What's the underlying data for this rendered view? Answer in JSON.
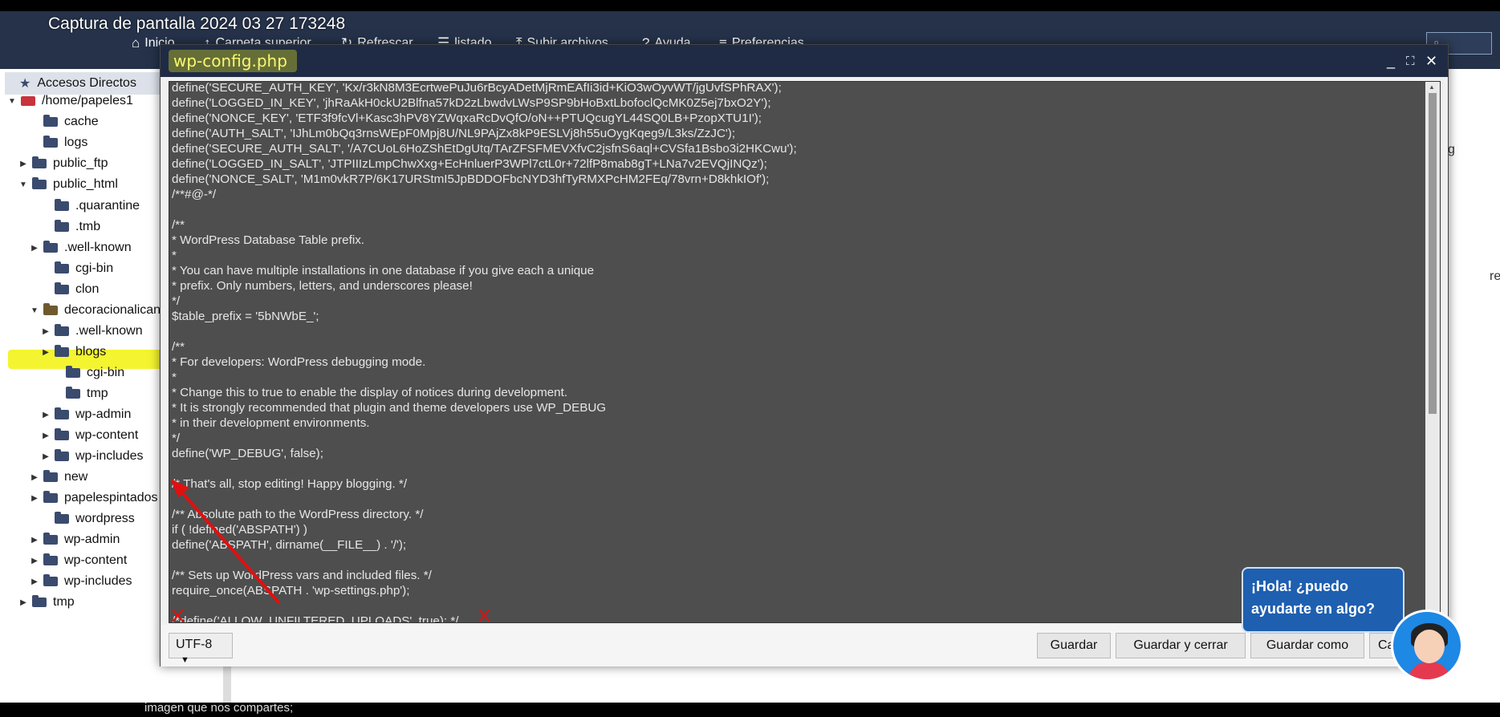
{
  "window": {
    "caption": "Captura de pantalla 2024 03 27 173248"
  },
  "toolbar": {
    "items": [
      {
        "label": "Inicio",
        "icon": "home-icon"
      },
      {
        "label": "Carpeta superior",
        "icon": "up-arrow-icon"
      },
      {
        "label": "Refrescar",
        "icon": "refresh-icon"
      },
      {
        "label": "listado",
        "icon": "list-icon"
      },
      {
        "label": "Subir archivos",
        "icon": "upload-icon"
      },
      {
        "label": "Ayuda",
        "icon": "help-icon"
      },
      {
        "label": "Preferencias",
        "icon": "sliders-icon"
      }
    ],
    "search_placeholder": ""
  },
  "sidebar": {
    "shortcut": "Accesos Directos",
    "root": "/home/papeles1",
    "items": [
      {
        "label": "cache"
      },
      {
        "label": "logs"
      },
      {
        "label": "public_ftp"
      },
      {
        "label": "public_html"
      },
      {
        "label": ".quarantine"
      },
      {
        "label": ".tmb"
      },
      {
        "label": ".well-known"
      },
      {
        "label": "cgi-bin"
      },
      {
        "label": "clon"
      },
      {
        "label": "decoracionalican"
      },
      {
        "label": ".well-known"
      },
      {
        "label": "blogs"
      },
      {
        "label": "cgi-bin"
      },
      {
        "label": "tmp"
      },
      {
        "label": "wp-admin"
      },
      {
        "label": "wp-content"
      },
      {
        "label": "wp-includes"
      },
      {
        "label": "new"
      },
      {
        "label": "papelespintados"
      },
      {
        "label": "wordpress"
      },
      {
        "label": "wp-admin"
      },
      {
        "label": "wp-content"
      },
      {
        "label": "wp-includes"
      },
      {
        "label": "tmp"
      }
    ]
  },
  "background": {
    "right_fragment_1": "g",
    "right_fragment_2": "re",
    "bottom_text": "imagen que nos compartes;"
  },
  "dialog": {
    "title": "wp-config.php",
    "code_lines": [
      "define('SECURE_AUTH_KEY', 'Kx/r3kN8M3EcrtwePuJu6rBcyADetMjRmEAfIi3id+KiO3wOyvWT/jgUvfSPhRAX');",
      "define('LOGGED_IN_KEY', 'jhRaAkH0ckU2Blfna57kD2zLbwdvLWsP9SP9bHoBxtLbofoclQcMK0Z5ej7bxO2Y');",
      "define('NONCE_KEY', 'ETF3f9fcVl+Kasc3hPV8YZWqxaRcDvQfO/oN++PTUQcugYL44SQ0LB+PzopXTU1I');",
      "define('AUTH_SALT', 'IJhLm0bQq3rnsWEpF0Mpj8U/NL9PAjZx8kP9ESLVj8h55uOygKqeg9/L3ks/ZzJC');",
      "define('SECURE_AUTH_SALT', '/A7CUoL6HoZShEtDgUtq/TArZFSFMEVXfvC2jsfnS6aql+CVSfa1Bsbo3i2HKCwu');",
      "define('LOGGED_IN_SALT', 'JTPIIIzLmpChwXxg+EcHnluerP3WPl7ctL0r+72lfP8mab8gT+LNa7v2EVQjINQz');",
      "define('NONCE_SALT', 'M1m0vkR7P/6K17URStmI5JpBDDOFbcNYD3hfTyRMXPcHM2FEq/78vrn+D8khkIOf');",
      "/**#@-*/",
      "",
      "/**",
      "* WordPress Database Table prefix.",
      "*",
      "* You can have multiple installations in one database if you give each a unique",
      "* prefix. Only numbers, letters, and underscores please!",
      "*/",
      "$table_prefix = '5bNWbE_';",
      "",
      "/**",
      "* For developers: WordPress debugging mode.",
      "*",
      "* Change this to true to enable the display of notices during development.",
      "* It is strongly recommended that plugin and theme developers use WP_DEBUG",
      "* in their development environments.",
      "*/",
      "define('WP_DEBUG', false);",
      "",
      "/* That's all, stop editing! Happy blogging. */",
      "",
      "/** Absolute path to the WordPress directory. */",
      "if ( !defined('ABSPATH') )",
      "define('ABSPATH', dirname(__FILE__) . '/');",
      "",
      "/** Sets up WordPress vars and included files. */",
      "require_once(ABSPATH . 'wp-settings.php');",
      "",
      "/*define('ALLOW_UNFILTERED_UPLOADS', true); */"
    ],
    "encoding": "UTF-8",
    "buttons": {
      "save": "Guardar",
      "save_close": "Guardar y cerrar",
      "save_as": "Guardar como",
      "cancel": "Ca"
    }
  },
  "chat": {
    "line1": "¡Hola! ¿puedo",
    "line2": "ayudarte en algo?"
  },
  "colors": {
    "toolbar": "#25324a",
    "dialog_head": "#1f2b45",
    "editor_bg": "#4e4e4e",
    "highlight": "#f3f31a",
    "annotation": "#e01010",
    "chat": "#1e5fb0"
  }
}
